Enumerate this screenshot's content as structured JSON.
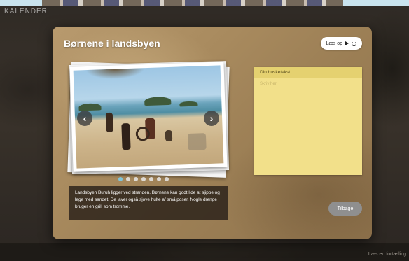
{
  "background": {
    "title": "KALENDER",
    "footer_text": "Læs en fortælling"
  },
  "dialog": {
    "title": "Børnene i landsbyen",
    "read_button_label": "Læs op",
    "caption": "Landsbyen Buruh ligger ved stranden. Børnene kan godt lide at sjippe og lege med sandet. De laver også sjove hulte af små poser. Nogle drenge bruger en grill som tromme.",
    "back_button_label": "Tilbage",
    "slides_total": 7,
    "slide_active_index": 0
  },
  "note": {
    "title": "Din husketekst",
    "placeholder": "Skriv her"
  },
  "icons": {
    "prev": "chevron-left-icon",
    "next": "chevron-right-icon",
    "play": "play-icon",
    "replay": "replay-icon"
  },
  "colors": {
    "note": "#f2e08a",
    "dot_active": "#7fc4d9",
    "back_button": "#8f8f8f"
  }
}
